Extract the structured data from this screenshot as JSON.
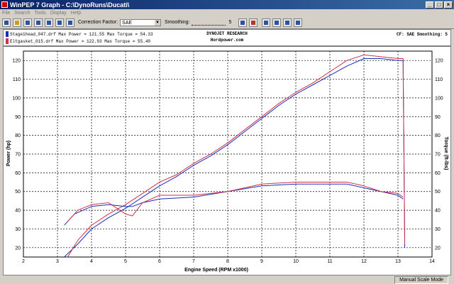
{
  "window": {
    "title": "WinPEP 7    Graph - C:\\DynoRuns\\Ducati\\"
  },
  "menu": [
    "File",
    "Search",
    "Tools",
    "Display",
    "Help"
  ],
  "toolbar": {
    "correction_label": "Correction Factor:",
    "correction_value": "SAE",
    "smoothing_label": "Smoothing:",
    "smoothing_value": "5"
  },
  "header": {
    "run1": "Stage1head_047.drf Max Power = 121.55 Max Torque = 54.33",
    "run2": "Eltgasket_015.drf Max Power = 122.93 Max Torque = 55.40",
    "company": "DYNOJET RESEARCH",
    "site": "Hordpower.com",
    "cf": "CF: SAE  Smoothing: 5"
  },
  "colors": {
    "run1": "#1a2fb8",
    "run2": "#d03048"
  },
  "status": {
    "mode": "Manual Scale Mode"
  },
  "chart_data": {
    "type": "line",
    "xlabel": "Engine Speed (RPM x1000)",
    "ylabel_left": "Power (hp)",
    "ylabel_right": "Torque (ft-lbs)",
    "xlim": [
      2,
      14
    ],
    "ylim": [
      15,
      125
    ],
    "xticks": [
      2,
      3,
      4,
      5,
      6,
      7,
      8,
      9,
      10,
      11,
      12,
      13,
      14
    ],
    "yticks": [
      20,
      30,
      40,
      50,
      60,
      70,
      80,
      90,
      100,
      110,
      120
    ],
    "grid": true,
    "series": [
      {
        "name": "Stage1head_047.drf",
        "kind": "power",
        "x": [
          3.2,
          3.6,
          4.0,
          4.5,
          5.0,
          5.5,
          6.0,
          6.5,
          7.0,
          7.5,
          8.0,
          8.5,
          9.0,
          9.5,
          10.0,
          10.5,
          11.0,
          11.5,
          12.0,
          12.5,
          13.0,
          13.15,
          13.2
        ],
        "y": [
          15,
          22,
          30,
          36,
          41,
          47,
          53,
          58,
          64,
          69,
          75,
          82,
          89,
          96,
          102,
          107,
          112,
          117,
          121,
          121,
          120,
          120,
          20
        ]
      },
      {
        "name": "Eltgasket_015.drf",
        "kind": "power",
        "x": [
          3.3,
          3.6,
          4.0,
          4.5,
          5.0,
          5.5,
          6.0,
          6.5,
          7.0,
          7.5,
          8.0,
          8.5,
          9.0,
          9.5,
          10.0,
          10.5,
          11.0,
          11.5,
          12.0,
          12.5,
          13.0,
          13.15,
          13.2
        ],
        "y": [
          15,
          24,
          32,
          38,
          43,
          49,
          55,
          59,
          65,
          70,
          76,
          83,
          90,
          97,
          103,
          108,
          114,
          120,
          123,
          122,
          121,
          121,
          22
        ]
      },
      {
        "name": "Stage1head_047.drf",
        "kind": "torque",
        "x": [
          3.2,
          3.5,
          4.0,
          4.5,
          5.0,
          5.2,
          5.5,
          6.0,
          7.0,
          8.0,
          9.0,
          10.0,
          11.0,
          11.5,
          12.0,
          12.5,
          13.0,
          13.15
        ],
        "y": [
          32,
          38,
          42,
          43,
          42,
          42,
          44,
          46,
          47,
          50,
          53,
          54,
          54,
          54,
          52,
          50,
          48,
          46
        ]
      },
      {
        "name": "Eltgasket_015.drf",
        "kind": "torque",
        "x": [
          3.3,
          3.6,
          4.0,
          4.5,
          5.0,
          5.2,
          5.5,
          6.0,
          7.0,
          8.0,
          9.0,
          10.0,
          11.0,
          11.5,
          12.0,
          12.5,
          13.0,
          13.15
        ],
        "y": [
          34,
          40,
          43,
          44,
          38,
          37,
          44,
          48,
          48,
          50,
          54,
          55,
          55,
          55,
          53,
          50,
          49,
          47
        ]
      }
    ]
  }
}
